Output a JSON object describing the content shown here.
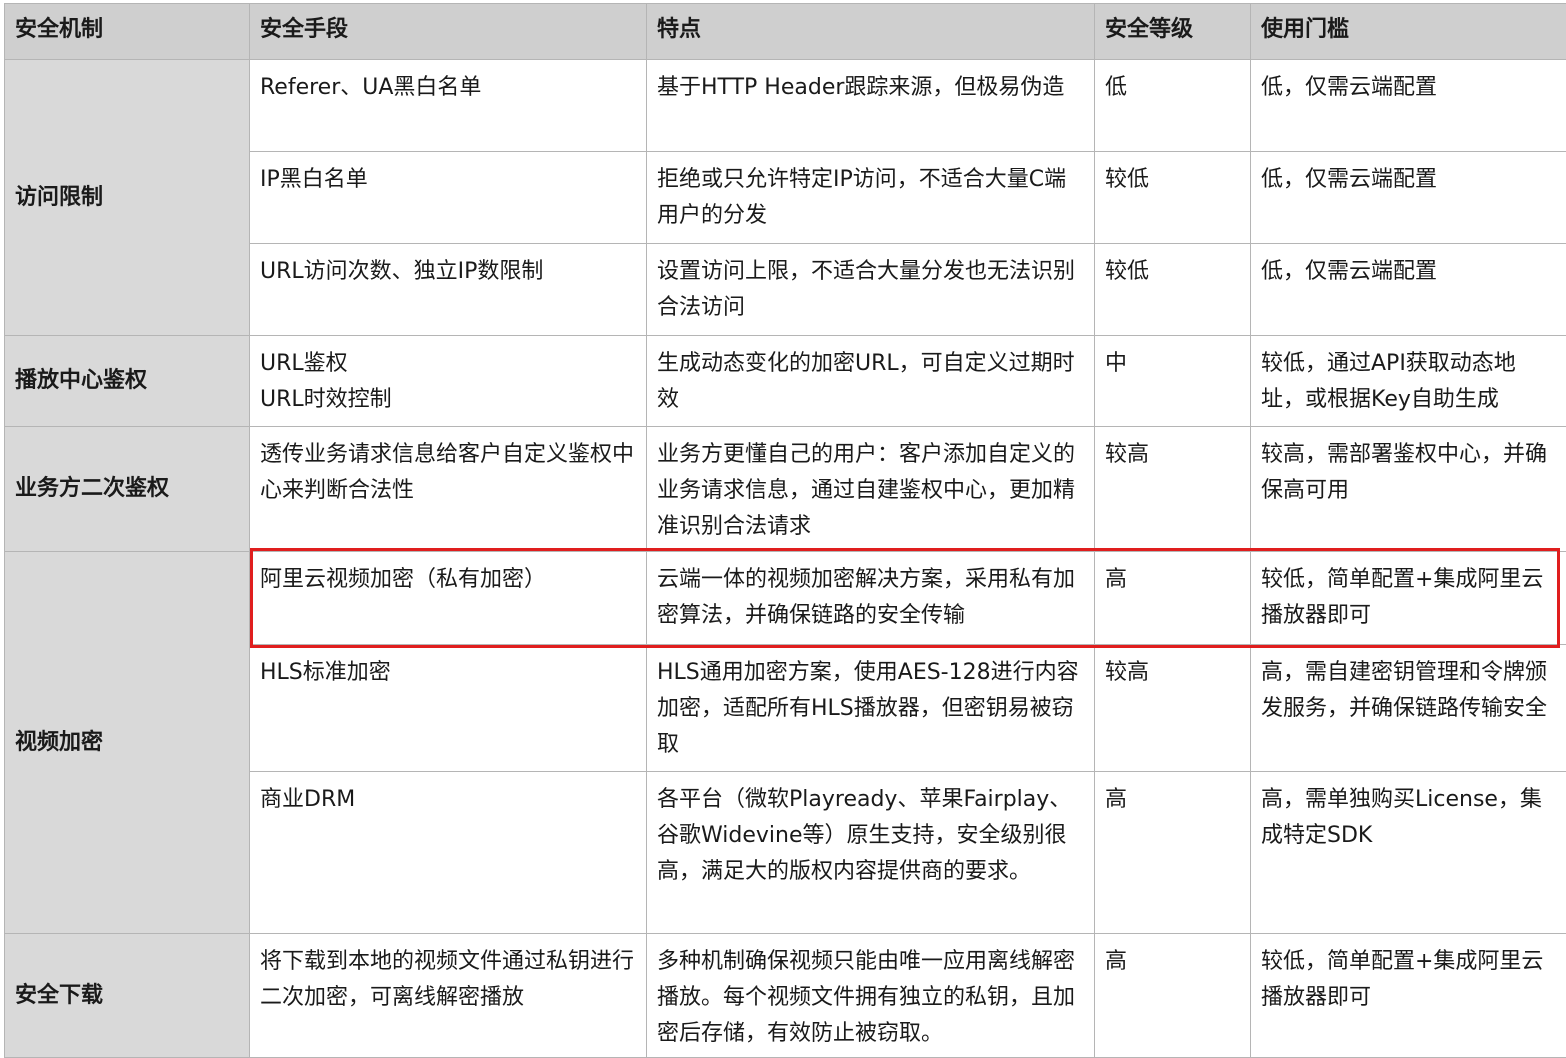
{
  "headers": [
    "安全机制",
    "安全手段",
    "特点",
    "安全等级",
    "使用门槛"
  ],
  "groups": [
    {
      "mechanism": "访问限制",
      "rows": [
        {
          "means": "Referer、UA黑白名单",
          "feature": "基于HTTP Header跟踪来源，但极易伪造",
          "level": "低",
          "threshold": "低，仅需云端配置"
        },
        {
          "means": "IP黑白名单",
          "feature": "拒绝或只允许特定IP访问，不适合大量C端用户的分发",
          "level": "较低",
          "threshold": "低，仅需云端配置"
        },
        {
          "means": "URL访问次数、独立IP数限制",
          "feature": "设置访问上限，不适合大量分发也无法识别合法访问",
          "level": "较低",
          "threshold": "低，仅需云端配置"
        }
      ]
    },
    {
      "mechanism": "播放中心鉴权",
      "rows": [
        {
          "means": "URL鉴权\nURL时效控制",
          "feature": "生成动态变化的加密URL，可自定义过期时效",
          "level": "中",
          "threshold": "较低，通过API获取动态地址，或根据Key自助生成"
        }
      ]
    },
    {
      "mechanism": "业务方二次鉴权",
      "rows": [
        {
          "means": "透传业务请求信息给客户自定义鉴权中心来判断合法性",
          "feature": "业务方更懂自己的用户：客户添加自定义的业务请求信息，通过自建鉴权中心，更加精准识别合法请求",
          "level": "较高",
          "threshold": "较高，需部署鉴权中心，并确保高可用"
        }
      ]
    },
    {
      "mechanism": "视频加密",
      "rows": [
        {
          "means": "阿里云视频加密（私有加密）",
          "feature": "云端一体的视频加密解决方案，采用私有加密算法，并确保链路的安全传输",
          "level": "高",
          "threshold": "较低，简单配置+集成阿里云播放器即可"
        },
        {
          "means": "HLS标准加密",
          "feature": "HLS通用加密方案，使用AES-128进行内容加密，适配所有HLS播放器，但密钥易被窃取",
          "level": "较高",
          "threshold": "高，需自建密钥管理和令牌颁发服务，并确保链路传输安全"
        },
        {
          "means": "商业DRM",
          "feature": "各平台（微软Playready、苹果Fairplay、谷歌Widevine等）原生支持，安全级别很高，满足大的版权内容提供商的要求。",
          "level": "高",
          "threshold": "高，需单独购买License，集成特定SDK"
        }
      ]
    },
    {
      "mechanism": "安全下载",
      "rows": [
        {
          "means": "将下载到本地的视频文件通过私钥进行二次加密，可离线解密播放",
          "feature": "多种机制确保视频只能由唯一应用离线解密播放。每个视频文件拥有独立的私钥，且加密后存储，有效防止被窃取。",
          "level": "高",
          "threshold": "较低，简单配置+集成阿里云播放器即可"
        }
      ]
    }
  ]
}
